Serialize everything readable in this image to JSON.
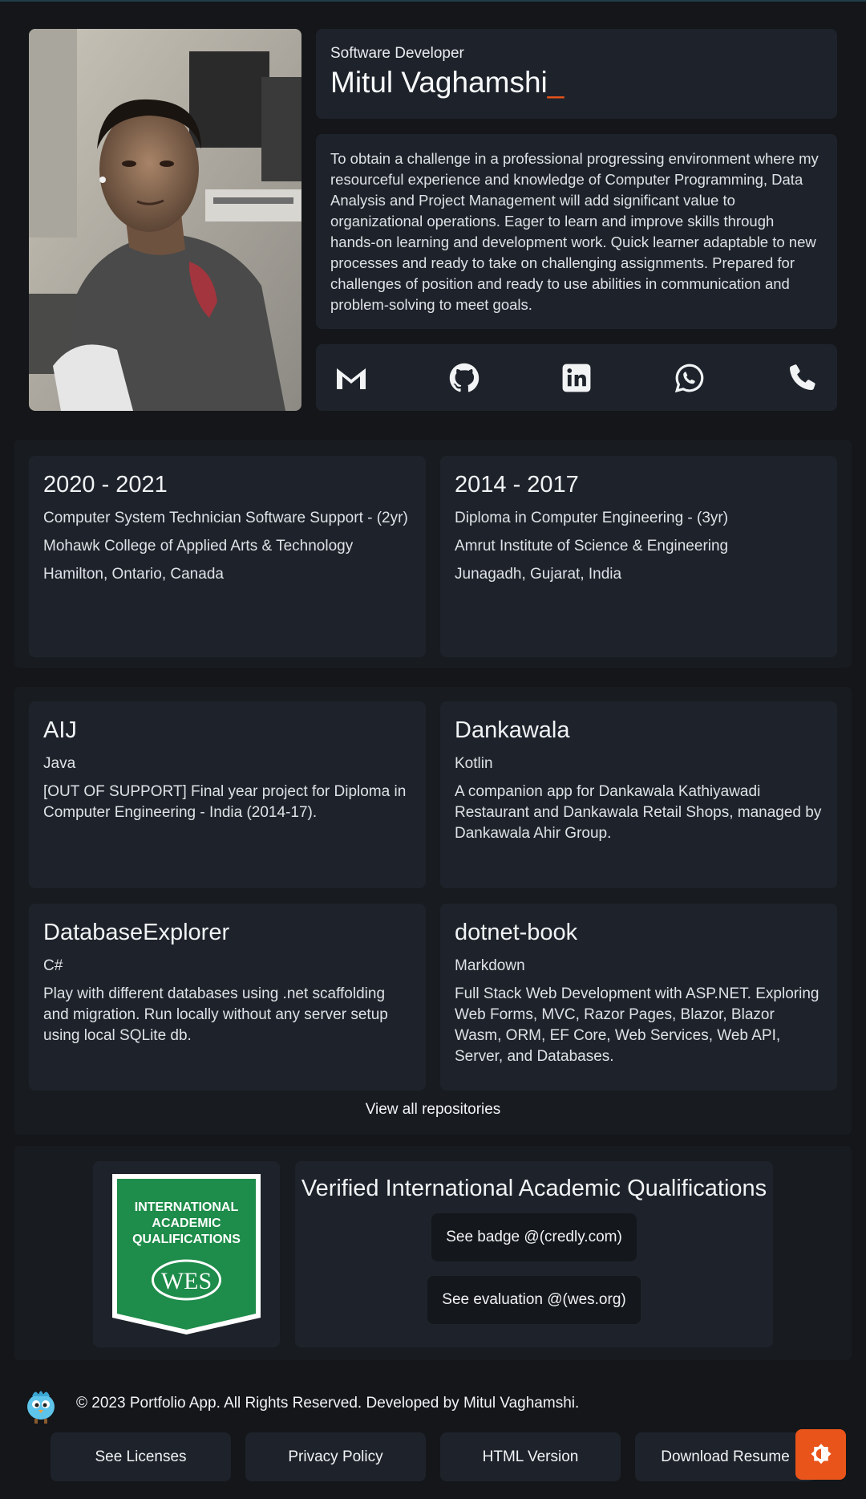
{
  "hero": {
    "role": "Software Developer",
    "name": "Mitul Vaghamshi",
    "cursor": "_",
    "about": "To obtain a challenge in a professional progressing environment where my resourceful experience and knowledge of Computer Programming, Data Analysis and Project Management will add significant value to organizational operations. Eager to learn and improve skills through hands-on learning and development work. Quick learner adaptable to new processes and ready to take on challenging assignments. Prepared for challenges of position and ready to use abilities in communication and problem-solving to meet goals.",
    "social_icons": [
      "gmail-icon",
      "github-icon",
      "linkedin-icon",
      "whatsapp-icon",
      "phone-icon"
    ]
  },
  "education": [
    {
      "years": "2020 - 2021",
      "program": "Computer System Technician Software Support - (2yr)",
      "school": "Mohawk College of Applied Arts & Technology",
      "location": "Hamilton, Ontario, Canada"
    },
    {
      "years": "2014 - 2017",
      "program": "Diploma in Computer Engineering - (3yr)",
      "school": "Amrut Institute of Science & Engineering",
      "location": "Junagadh, Gujarat, India"
    }
  ],
  "repos": [
    {
      "name": "AIJ",
      "lang": "Java",
      "desc": "[OUT OF SUPPORT] Final year project for Diploma in Computer Engineering - India (2014-17)."
    },
    {
      "name": "Dankawala",
      "lang": "Kotlin",
      "desc": "A companion app for Dankawala Kathiyawadi Restaurant and Dankawala Retail Shops, managed by Dankawala Ahir Group."
    },
    {
      "name": "DatabaseExplorer",
      "lang": "C#",
      "desc": "Play with different databases using .net scaffolding and migration. Run locally without any server setup using local SQLite db."
    },
    {
      "name": "dotnet-book",
      "lang": "Markdown",
      "desc": "Full Stack Web Development with ASP.NET. Exploring Web Forms, MVC, Razor Pages, Blazor, Blazor Wasm, ORM, EF Core, Web Services, Web API, Server, and Databases."
    }
  ],
  "view_all": "View all repositories",
  "wes": {
    "badge_line1": "INTERNATIONAL",
    "badge_line2": "ACADEMIC",
    "badge_line3": "QUALIFICATIONS",
    "badge_logo": "WES",
    "title": "Verified International Academic Qualifications",
    "badge_button": "See badge @(credly.com)",
    "eval_button": "See evaluation @(wes.org)"
  },
  "footer": {
    "copyright": "© 2023 Portfolio App. All Rights Reserved. Developed by Mitul Vaghamshi.",
    "buttons": [
      "See Licenses",
      "Privacy Policy",
      "HTML Version",
      "Download Resume"
    ]
  },
  "colors": {
    "accent": "#e8541a",
    "card": "#1e232b",
    "background": "#141619",
    "badge_green": "#1e8c4a"
  }
}
